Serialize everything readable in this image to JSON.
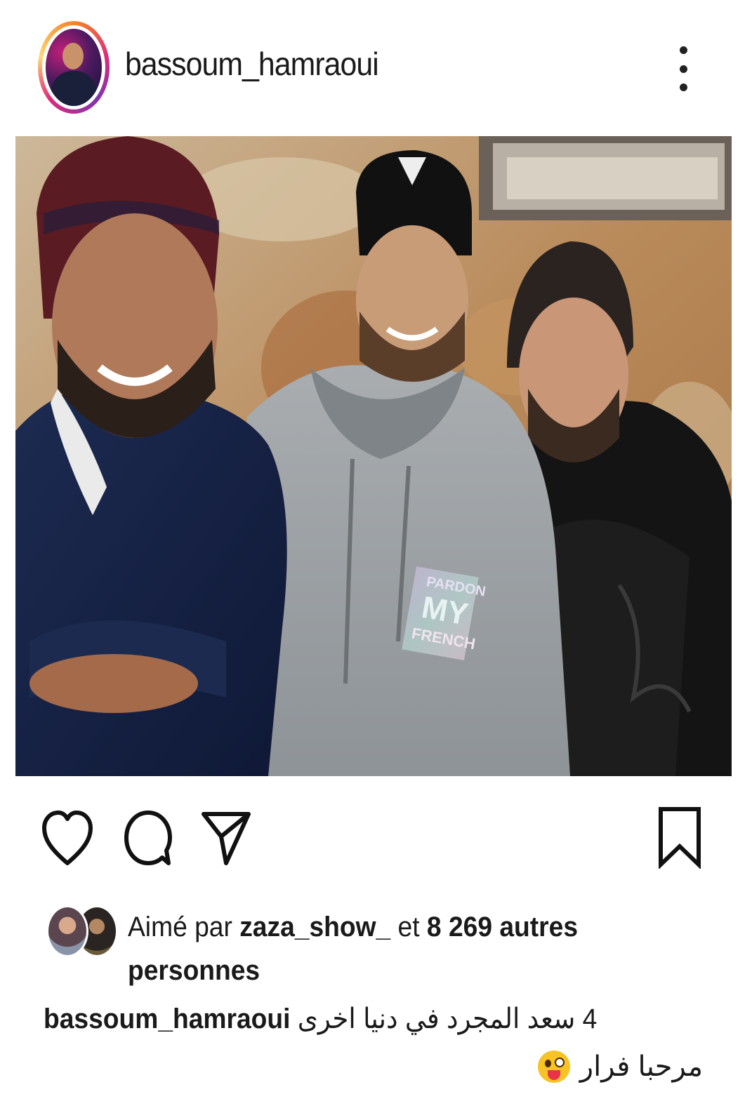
{
  "post": {
    "username": "bassoum_hamraoui",
    "photo_hoodie_text": [
      "PARDON",
      "MY",
      "FRENCH"
    ]
  },
  "icons": {
    "more": "more-vertical-icon",
    "like": "heart-icon",
    "comment": "comment-icon",
    "share": "send-icon",
    "save": "bookmark-icon"
  },
  "likes": {
    "prefix": "Aimé par ",
    "user": "zaza_show_",
    "middle": " et ",
    "count_text": "8 269 autres personnes"
  },
  "caption": {
    "username": "bassoum_hamraoui",
    "text_line1": "4 سعد المجرد في دنيا اخرى",
    "text_line2": "مرحبا فرار",
    "emoji": "zany-face-emoji"
  },
  "colors": {
    "story_ring": [
      "#f58529",
      "#dd2a7b",
      "#8134af"
    ],
    "text": "#1a1a1a"
  }
}
